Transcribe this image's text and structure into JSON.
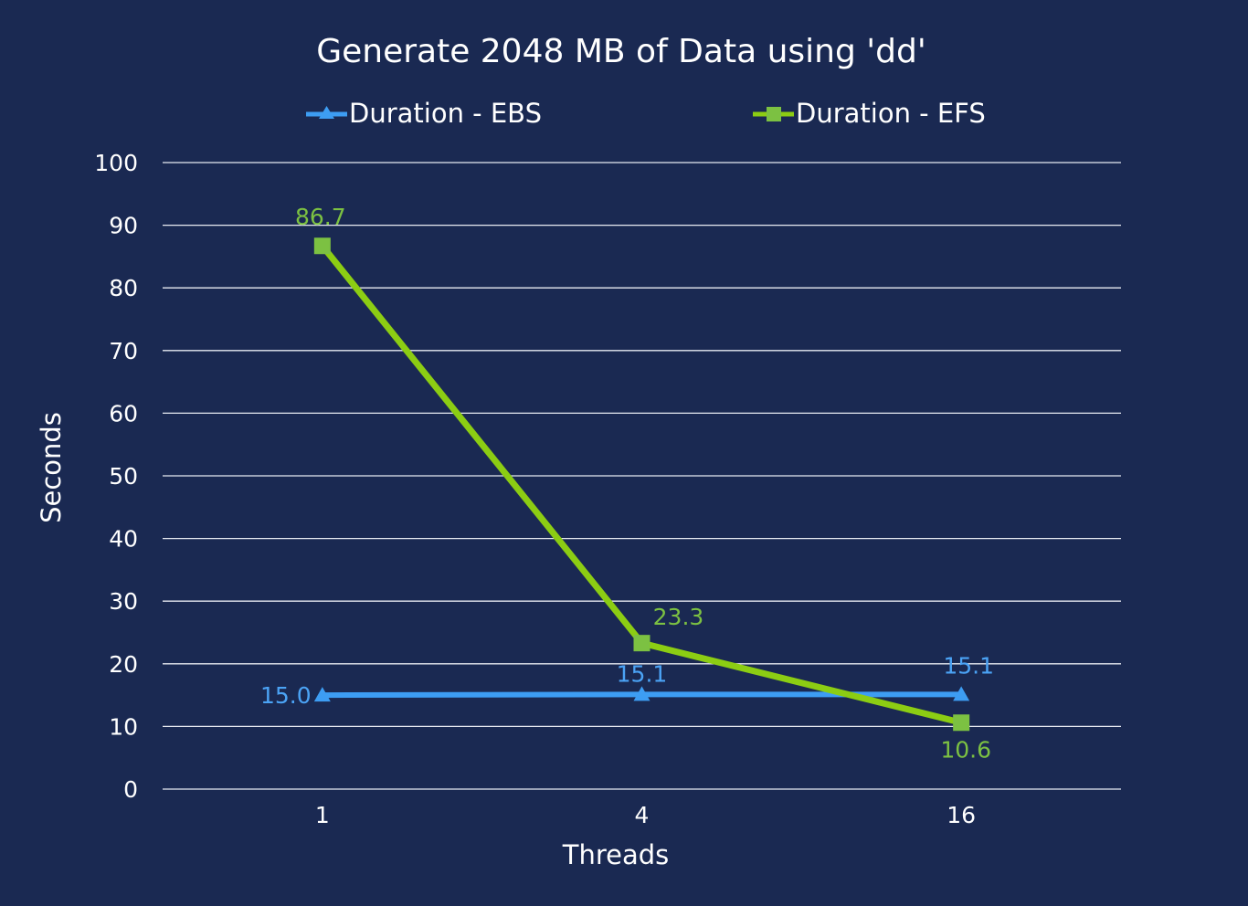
{
  "colors": {
    "background": "#1a2952",
    "grid": "#e8ebf2",
    "text": "#ffffff"
  },
  "chart_data": {
    "type": "line",
    "title": "Generate 2048 MB of Data using 'dd'",
    "xlabel": "Threads",
    "ylabel": "Seconds",
    "categories": [
      "1",
      "4",
      "16"
    ],
    "ylim": [
      0,
      100
    ],
    "yticks": [
      "0",
      "10",
      "20",
      "30",
      "40",
      "50",
      "60",
      "70",
      "80",
      "90",
      "100"
    ],
    "grid": true,
    "legend_position": "top",
    "series": [
      {
        "name": "Duration - EBS",
        "values": [
          15.0,
          15.1,
          15.1
        ],
        "labels": [
          "15.0",
          "15.1",
          "15.1"
        ],
        "color": "#3d9df3",
        "label_color": "#4ba3f5",
        "marker": "triangle"
      },
      {
        "name": "Duration - EFS",
        "values": [
          86.7,
          23.3,
          10.6
        ],
        "labels": [
          "86.7",
          "23.3",
          "10.6"
        ],
        "color": "#8ccd13",
        "label_color": "#7cc142",
        "marker": "square"
      }
    ]
  }
}
